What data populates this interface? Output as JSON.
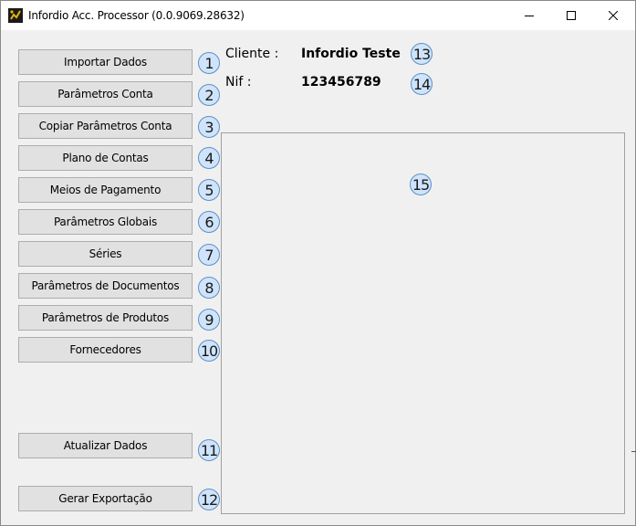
{
  "window": {
    "title": "Infordio Acc. Processor (0.0.9069.28632)"
  },
  "menu": {
    "items": [
      {
        "label": "Importar Dados",
        "badge": "1"
      },
      {
        "label": "Parâmetros Conta",
        "badge": "2"
      },
      {
        "label": "Copiar Parâmetros Conta",
        "badge": "3"
      },
      {
        "label": "Plano de Contas",
        "badge": "4"
      },
      {
        "label": "Meios de Pagamento",
        "badge": "5"
      },
      {
        "label": "Parâmetros Globais",
        "badge": "6"
      },
      {
        "label": "Séries",
        "badge": "7"
      },
      {
        "label": "Parâmetros de Documentos",
        "badge": "8"
      },
      {
        "label": "Parâmetros de Produtos",
        "badge": "9"
      },
      {
        "label": "Fornecedores",
        "badge": "10"
      }
    ],
    "update": {
      "label": "Atualizar Dados",
      "badge": "11"
    },
    "export": {
      "label": "Gerar Exportação",
      "badge": "12"
    }
  },
  "info": {
    "client_label": "Cliente :",
    "client_value": "Infordio Teste",
    "client_badge": "13",
    "nif_label": "Nif :",
    "nif_value": "123456789",
    "nif_badge": "14"
  },
  "panel": {
    "badge": "15"
  },
  "colors": {
    "badge_fill": "#cfe4fb",
    "badge_border": "#5b8fc4",
    "button_face": "#e1e1e1",
    "button_border": "#adadad"
  }
}
